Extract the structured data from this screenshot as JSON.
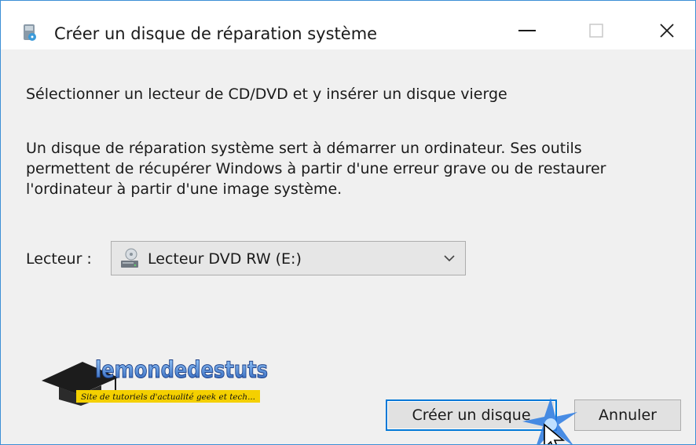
{
  "window": {
    "title": "Créer un disque de réparation système",
    "controls": {
      "minimize": "minimize-icon",
      "maximize": "maximize-icon",
      "close": "close-icon"
    }
  },
  "main": {
    "heading": "Sélectionner un lecteur de CD/DVD et y insérer un disque vierge",
    "description_lines": [
      "Un disque de réparation système sert à démarrer un ordinateur. Ses outils",
      "permettent de récupérer Windows à partir d'une erreur grave ou de restaurer",
      "l'ordinateur à partir d'une image système."
    ],
    "drive": {
      "label": "Lecteur :",
      "selected": "Lecteur DVD RW (E:)"
    }
  },
  "watermark": {
    "brand": "lemondedestuts",
    "tagline": "Site de tutoriels d'actualité geek et tech..."
  },
  "buttons": {
    "create": "Créer un disque",
    "cancel": "Annuler"
  },
  "colors": {
    "accent": "#0078d7",
    "window_border": "#3c8fd6",
    "background": "#f0f0f0",
    "button_face": "#e1e1e1"
  }
}
